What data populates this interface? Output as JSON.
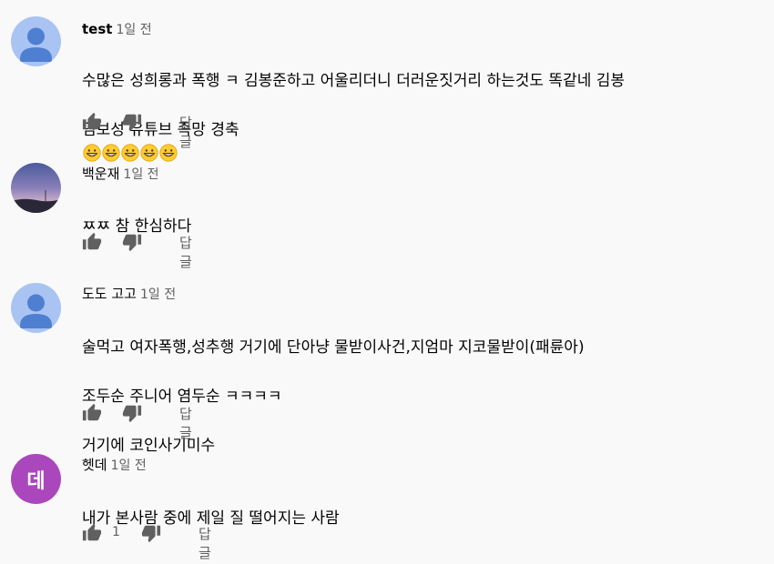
{
  "comments": [
    {
      "author": "test",
      "time": "1일 전",
      "avatar": {
        "type": "default-person",
        "color": "#4f7fd1",
        "bg": "#a9c4f2"
      },
      "text_lines": [
        "수많은 성희롱과 폭행 ㅋ 김봉준하고 어울리더니 더러운짓거리 하는것도 똑같네 김봉",
        "염보성 유튜브 족망 경축"
      ],
      "emoji_count": 5,
      "emoji": "grinning-face-icon",
      "likes": "",
      "reply_label": "답글"
    },
    {
      "author": "백운재",
      "time": "1일 전",
      "avatar": {
        "type": "photo-twilight-sky"
      },
      "text_lines": [
        "ㅉㅉ 참 한심하다"
      ],
      "likes": "",
      "reply_label": "답글"
    },
    {
      "author": "도도 고고",
      "time": "1일 전",
      "avatar": {
        "type": "default-person",
        "color": "#4f7fd1",
        "bg": "#a9c4f2"
      },
      "text_lines": [
        "술먹고 여자폭행,성추행 거기에 단아냥 물받이사건,지엄마 지코물받이(패륜아)",
        "조두순 주니어 염두순 ㅋㅋㅋㅋ",
        "거기에 코인사기미수"
      ],
      "likes": "",
      "reply_label": "답글"
    },
    {
      "author": "헷데",
      "time": "1일 전",
      "avatar": {
        "type": "letter",
        "letter": "데",
        "bg": "#ab47bc"
      },
      "text_lines": [
        "내가 본사람 중에 제일 질 떨어지는 사람"
      ],
      "likes": "1",
      "reply_label": "답글"
    }
  ],
  "colors": {
    "text": "#030303",
    "secondary": "#606060",
    "background": "#f9f9f9"
  }
}
